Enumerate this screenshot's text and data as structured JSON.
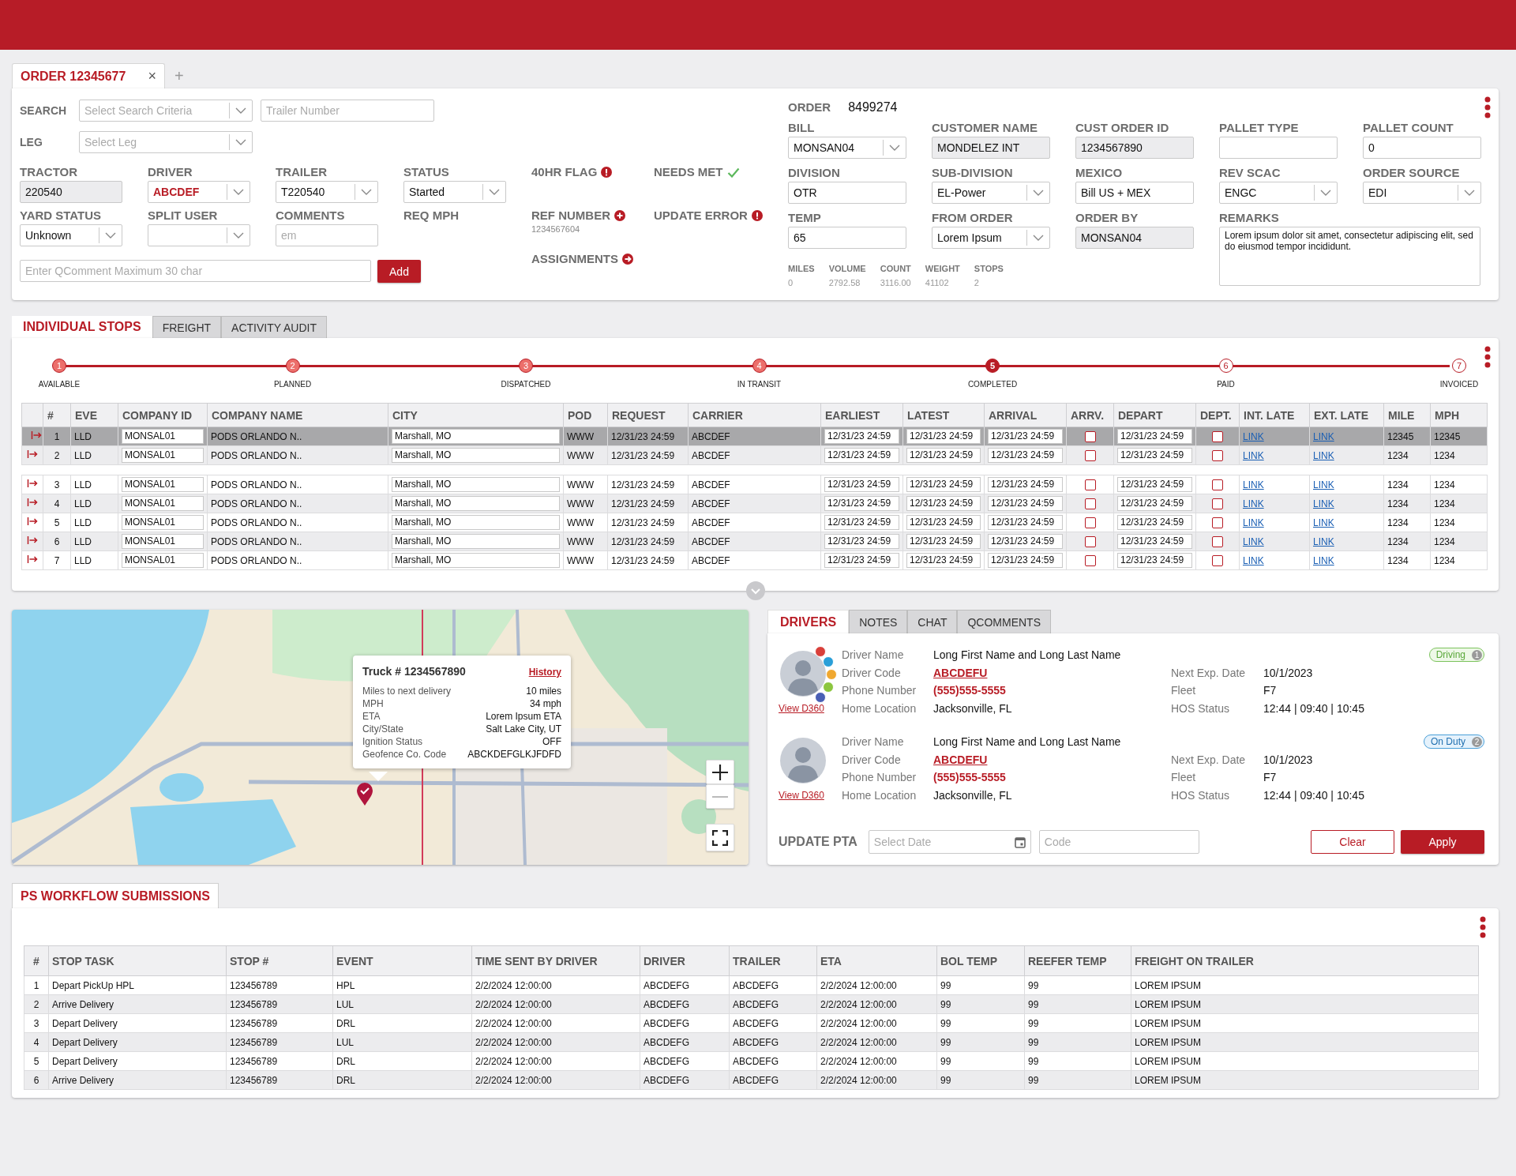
{
  "order_tabs": [
    {
      "label": "ORDER 12345677",
      "selected": true,
      "close": "×"
    }
  ],
  "new_tab": "+",
  "search": {
    "label": "SEARCH",
    "criteria": {
      "placeholder": "Select Search Criteria"
    },
    "trailer": {
      "placeholder": "Trailer Number"
    }
  },
  "leg": {
    "label": "LEG",
    "placeholder": "Select Leg"
  },
  "fields": [
    {
      "label": "TRACTOR",
      "kind": "readonly",
      "value": "220540",
      "highlight": false
    },
    {
      "label": "DRIVER",
      "kind": "select",
      "value": "ABCDEF",
      "highlight": true
    },
    {
      "label": "TRAILER",
      "kind": "select",
      "value": "T220540",
      "highlight": false
    },
    {
      "label": "STATUS",
      "kind": "select",
      "value": "Started",
      "highlight": false
    },
    {
      "label": "YARD STATUS",
      "kind": "select",
      "value": "Unknown",
      "highlight": false
    },
    {
      "label": "SPLIT USER",
      "kind": "select",
      "highlight": false
    },
    {
      "label": "COMMENTS",
      "kind": "text",
      "placeholder": "em",
      "highlight": false
    },
    {
      "label": "REQ MPH",
      "kind": "none",
      "highlight": false
    }
  ],
  "flags": [
    {
      "label": "40HR FLAG",
      "kind": "alert"
    },
    {
      "label": "NEEDS MET",
      "kind": "check"
    },
    {
      "label": "REF NUMBER",
      "kind": "add",
      "value": "1234567604"
    },
    {
      "label": "UPDATE ERROR",
      "kind": "alert"
    },
    {
      "label": "ASSIGNMENTS",
      "kind": "arrow"
    }
  ],
  "qcomment": {
    "placeholder": "Enter QComment Maximum 30 char",
    "button": "Add"
  },
  "order": {
    "label": "ORDER",
    "number": "8499274"
  },
  "order_fields": [
    {
      "label": "BILL",
      "kind": "select",
      "value": "MONSAN04"
    },
    {
      "label": "CUSTOMER NAME",
      "kind": "readonly",
      "value": "MONDELEZ INT"
    },
    {
      "label": "CUST ORDER ID",
      "kind": "readonly",
      "value": "1234567890"
    },
    {
      "label": "PALLET TYPE",
      "kind": "text"
    },
    {
      "label": "PALLET COUNT",
      "kind": "text",
      "value": "0"
    },
    {
      "label": "DIVISION",
      "kind": "text",
      "value": "OTR"
    },
    {
      "label": "SUB-DIVISION",
      "kind": "select",
      "value": "EL-Power"
    },
    {
      "label": "MEXICO",
      "kind": "text",
      "value": "Bill US + MEX"
    },
    {
      "label": "REV SCAC",
      "kind": "select",
      "value": "ENGC"
    },
    {
      "label": "ORDER SOURCE",
      "kind": "select",
      "value": "EDI"
    },
    {
      "label": "TEMP",
      "kind": "text",
      "value": "65"
    },
    {
      "label": "FROM ORDER",
      "kind": "select",
      "value": "Lorem Ipsum"
    },
    {
      "label": "ORDER BY",
      "kind": "readonly",
      "value": "MONSAN04"
    },
    {
      "label": "REMARKS",
      "kind": "textarea",
      "value": "Lorem ipsum dolor sit amet, consectetur adipiscing elit, sed do eiusmod tempor incididunt."
    }
  ],
  "stats": [
    {
      "label": "MILES",
      "value": "0"
    },
    {
      "label": "VOLUME",
      "value": "2792.58"
    },
    {
      "label": "COUNT",
      "value": "3116.00"
    },
    {
      "label": "WEIGHT",
      "value": "41102"
    },
    {
      "label": "STOPS",
      "value": "2"
    }
  ],
  "stops_tabs": [
    {
      "label": "INDIVIDUAL STOPS",
      "selected": true
    },
    {
      "label": "FREIGHT",
      "selected": false
    },
    {
      "label": "ACTIVITY AUDIT",
      "selected": false
    }
  ],
  "steps": [
    {
      "number": "1",
      "label": "AVAILABLE",
      "kind": "done"
    },
    {
      "number": "2",
      "label": "PLANNED",
      "kind": "done"
    },
    {
      "number": "3",
      "label": "DISPATCHED",
      "kind": "done"
    },
    {
      "number": "4",
      "label": "IN TRANSIT",
      "kind": "done"
    },
    {
      "number": "5",
      "label": "COMPLETED",
      "kind": "current"
    },
    {
      "number": "6",
      "label": "PAID",
      "kind": "pending"
    },
    {
      "number": "7",
      "label": "INVOICED",
      "kind": "pending"
    }
  ],
  "stops_table": {
    "columns": [
      "#",
      "EVE",
      "COMPANY ID",
      "COMPANY NAME",
      "CITY",
      "POD",
      "REQUEST",
      "CARRIER",
      "EARLIEST",
      "LATEST",
      "ARRIVAL",
      "ARRV.",
      "DEPART",
      "DEPT.",
      "INT. LATE",
      "EXT. LATE",
      "MILE",
      "MPH"
    ],
    "row_groups": [
      [
        {
          "selected": true,
          "number": "1",
          "eve": "LLD",
          "company_id": "MONSAL01",
          "company_name": "PODS ORLANDO N..",
          "city": "Marshall, MO",
          "pod": "WWW",
          "request": "12/31/23 24:59",
          "carrier": "ABCDEF",
          "earliest": "12/31/23 24:59",
          "latest": "12/31/23 24:59",
          "arrival": "12/31/23 24:59",
          "arrv": false,
          "depart": "12/31/23 24:59",
          "dept": false,
          "int_late": "LINK",
          "ext_late": "LINK",
          "mile": "12345",
          "mph": "12345"
        },
        {
          "selected": false,
          "number": "2",
          "eve": "LLD",
          "company_id": "MONSAL01",
          "company_name": "PODS ORLANDO N..",
          "city": "Marshall, MO",
          "pod": "WWW",
          "request": "12/31/23 24:59",
          "carrier": "ABCDEF",
          "earliest": "12/31/23 24:59",
          "latest": "12/31/23 24:59",
          "arrival": "12/31/23 24:59",
          "arrv": false,
          "depart": "12/31/23 24:59",
          "dept": false,
          "int_late": "LINK",
          "ext_late": "LINK",
          "mile": "1234",
          "mph": "1234"
        }
      ],
      [
        {
          "selected": false,
          "number": "3",
          "eve": "LLD",
          "company_id": "MONSAL01",
          "company_name": "PODS ORLANDO N..",
          "city": "Marshall, MO",
          "pod": "WWW",
          "request": "12/31/23 24:59",
          "carrier": "ABCDEF",
          "earliest": "12/31/23 24:59",
          "latest": "12/31/23 24:59",
          "arrival": "12/31/23 24:59",
          "arrv": false,
          "depart": "12/31/23 24:59",
          "dept": false,
          "int_late": "LINK",
          "ext_late": "LINK",
          "mile": "1234",
          "mph": "1234"
        },
        {
          "selected": false,
          "number": "4",
          "eve": "LLD",
          "company_id": "MONSAL01",
          "company_name": "PODS ORLANDO N..",
          "city": "Marshall, MO",
          "pod": "WWW",
          "request": "12/31/23 24:59",
          "carrier": "ABCDEF",
          "earliest": "12/31/23 24:59",
          "latest": "12/31/23 24:59",
          "arrival": "12/31/23 24:59",
          "arrv": false,
          "depart": "12/31/23 24:59",
          "dept": false,
          "int_late": "LINK",
          "ext_late": "LINK",
          "mile": "1234",
          "mph": "1234"
        },
        {
          "selected": false,
          "number": "5",
          "eve": "LLD",
          "company_id": "MONSAL01",
          "company_name": "PODS ORLANDO N..",
          "city": "Marshall, MO",
          "pod": "WWW",
          "request": "12/31/23 24:59",
          "carrier": "ABCDEF",
          "earliest": "12/31/23 24:59",
          "latest": "12/31/23 24:59",
          "arrival": "12/31/23 24:59",
          "arrv": false,
          "depart": "12/31/23 24:59",
          "dept": false,
          "int_late": "LINK",
          "ext_late": "LINK",
          "mile": "1234",
          "mph": "1234"
        },
        {
          "selected": false,
          "number": "6",
          "eve": "LLD",
          "company_id": "MONSAL01",
          "company_name": "PODS ORLANDO N..",
          "city": "Marshall, MO",
          "pod": "WWW",
          "request": "12/31/23 24:59",
          "carrier": "ABCDEF",
          "earliest": "12/31/23 24:59",
          "latest": "12/31/23 24:59",
          "arrival": "12/31/23 24:59",
          "arrv": false,
          "depart": "12/31/23 24:59",
          "dept": false,
          "int_late": "LINK",
          "ext_late": "LINK",
          "mile": "1234",
          "mph": "1234"
        },
        {
          "selected": false,
          "number": "7",
          "eve": "LLD",
          "company_id": "MONSAL01",
          "company_name": "PODS ORLANDO N..",
          "city": "Marshall, MO",
          "pod": "WWW",
          "request": "12/31/23 24:59",
          "carrier": "ABCDEF",
          "earliest": "12/31/23 24:59",
          "latest": "12/31/23 24:59",
          "arrival": "12/31/23 24:59",
          "arrv": false,
          "depart": "12/31/23 24:59",
          "dept": false,
          "int_late": "LINK",
          "ext_late": "LINK",
          "mile": "1234",
          "mph": "1234"
        }
      ]
    ]
  },
  "map_popup": {
    "title": "Truck # 1234567890",
    "link": "History",
    "rows": [
      {
        "label": "Miles to next delivery",
        "value": "10 miles"
      },
      {
        "label": "MPH",
        "value": "34 mph"
      },
      {
        "label": "ETA",
        "value": "Lorem Ipsum ETA"
      },
      {
        "label": "City/State",
        "value": "Salt Lake City, UT"
      },
      {
        "label": "Ignition Status",
        "value": "OFF"
      },
      {
        "label": "Geofence Co. Code",
        "value": "ABCKDEFGLKJFDFD"
      }
    ]
  },
  "driver_tabs": [
    {
      "label": "DRIVERS",
      "selected": true
    },
    {
      "label": "NOTES",
      "selected": false
    },
    {
      "label": "CHAT",
      "selected": false
    },
    {
      "label": "QCOMMENTS",
      "selected": false
    }
  ],
  "drivers": [
    {
      "status": "Driving",
      "kind": "driving",
      "status_count": "1",
      "view_link": "View D360",
      "badges": [
        {
          "color": "#d9403a"
        },
        {
          "color": "#2a9fd8"
        },
        {
          "color": "#f0a830"
        },
        {
          "color": "#8cc63f"
        },
        {
          "color": "#4a5fb5"
        }
      ],
      "details": [
        {
          "label": "Driver Name",
          "value": "Long First Name and Long Last Name",
          "kind": "text"
        },
        {
          "label": "Driver Code",
          "value": "ABCDEFU",
          "kind": "code"
        },
        {
          "label": "Phone Number",
          "value": "(555)555-5555",
          "kind": "phone"
        },
        {
          "label": "Home Location",
          "value": "Jacksonville, FL",
          "kind": "text"
        }
      ],
      "extra": [
        {
          "label": "Next Exp. Date",
          "value": "10/1/2023"
        },
        {
          "label": "Fleet",
          "value": "F7"
        },
        {
          "label": "HOS Status",
          "value": "12:44 | 09:40 | 10:45"
        }
      ]
    },
    {
      "status": "On Duty",
      "kind": "on_duty",
      "status_count": "2",
      "view_link": "View D360",
      "details": [
        {
          "label": "Driver Name",
          "value": "Long First Name and Long Last Name",
          "kind": "text"
        },
        {
          "label": "Driver Code",
          "value": "ABCDEFU",
          "kind": "code"
        },
        {
          "label": "Phone Number",
          "value": "(555)555-5555",
          "kind": "phone"
        },
        {
          "label": "Home Location",
          "value": "Jacksonville, FL",
          "kind": "text"
        }
      ],
      "extra": [
        {
          "label": "Next Exp. Date",
          "value": "10/1/2023"
        },
        {
          "label": "Fleet",
          "value": "F7"
        },
        {
          "label": "HOS Status",
          "value": "12:44 | 09:40 | 10:45"
        }
      ]
    }
  ],
  "update_pta": {
    "label": "UPDATE PTA",
    "date_placeholder": "Select Date",
    "code_placeholder": "Code",
    "clear": "Clear",
    "apply": "Apply"
  },
  "workflow_tabs": [
    {
      "label": "PS WORKFLOW SUBMISSIONS",
      "selected": true
    }
  ],
  "workflow": {
    "columns": [
      "#",
      "STOP TASK",
      "STOP #",
      "EVENT",
      "TIME SENT BY DRIVER",
      "DRIVER",
      "TRAILER",
      "ETA",
      "BOL TEMP",
      "REEFER TEMP",
      "FREIGHT ON TRAILER"
    ],
    "rows": [
      [
        "1",
        "Depart PickUp HPL",
        "123456789",
        "HPL",
        "2/2/2024 12:00:00",
        "ABCDEFG",
        "ABCDEFG",
        "2/2/2024 12:00:00",
        "99",
        "99",
        "LOREM IPSUM"
      ],
      [
        "2",
        "Arrive Delivery",
        "123456789",
        "LUL",
        "2/2/2024 12:00:00",
        "ABCDEFG",
        "ABCDEFG",
        "2/2/2024 12:00:00",
        "99",
        "99",
        "LOREM IPSUM"
      ],
      [
        "3",
        "Depart Delivery",
        "123456789",
        "DRL",
        "2/2/2024 12:00:00",
        "ABCDEFG",
        "ABCDEFG",
        "2/2/2024 12:00:00",
        "99",
        "99",
        "LOREM IPSUM"
      ],
      [
        "4",
        "Depart Delivery",
        "123456789",
        "LUL",
        "2/2/2024 12:00:00",
        "ABCDEFG",
        "ABCDEFG",
        "2/2/2024 12:00:00",
        "99",
        "99",
        "LOREM IPSUM"
      ],
      [
        "5",
        "Depart Delivery",
        "123456789",
        "DRL",
        "2/2/2024 12:00:00",
        "ABCDEFG",
        "ABCDEFG",
        "2/2/2024 12:00:00",
        "99",
        "99",
        "LOREM IPSUM"
      ],
      [
        "6",
        "Arrive Delivery",
        "123456789",
        "DRL",
        "2/2/2024 12:00:00",
        "ABCDEFG",
        "ABCDEFG",
        "2/2/2024 12:00:00",
        "99",
        "99",
        "LOREM IPSUM"
      ]
    ]
  }
}
